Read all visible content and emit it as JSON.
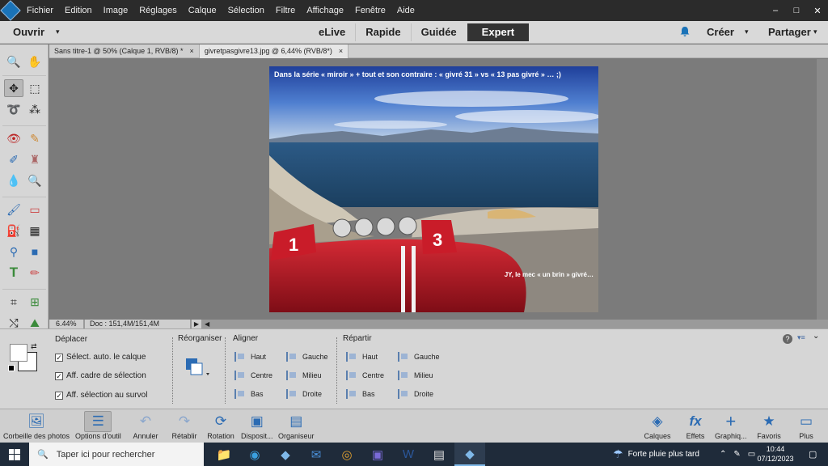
{
  "menubar": {
    "items": [
      "Fichier",
      "Edition",
      "Image",
      "Réglages",
      "Calque",
      "Sélection",
      "Filtre",
      "Affichage",
      "Fenêtre",
      "Aide"
    ],
    "window_controls": [
      "–",
      "□",
      "✕"
    ]
  },
  "modebar": {
    "open_label": "Ouvrir",
    "tabs": [
      "eLive",
      "Rapide",
      "Guidée",
      "Expert"
    ],
    "active_tab": "Expert",
    "create_label": "Créer",
    "share_label": "Partager"
  },
  "doc_tabs": [
    {
      "label": "Sans titre-1 @ 50% (Calque 1, RVB/8) *",
      "close": "×"
    },
    {
      "label": "givretpasgivre13.jpg @ 6,44% (RVB/8*)",
      "close": "×"
    }
  ],
  "photo": {
    "caption_top": "Dans la série « miroir » + tout et son contraire : « givré 31 » vs « 13 pas givré » … ;)",
    "caption_bottom": "JY, le mec « un brin » givré…",
    "number_left": "1",
    "number_right": "3"
  },
  "status": {
    "zoom": "6.44%",
    "doc_info": "Doc : 151,4M/151,4M",
    "arrow": "▶"
  },
  "options": {
    "move_title": "Déplacer",
    "checks": [
      {
        "label": "Sélect. auto. le calque",
        "checked": "✓"
      },
      {
        "label": "Aff. cadre de sélection",
        "checked": "✓"
      },
      {
        "label": "Aff. sélection au survol",
        "checked": "✓"
      }
    ],
    "arrange_title": "Réorganiser",
    "align_title": "Aligner",
    "align_items": [
      "Haut",
      "Centre",
      "Bas",
      "Gauche",
      "Milieu",
      "Droite"
    ],
    "distribute_title": "Répartir",
    "distribute_items": [
      "Haut",
      "Centre",
      "Bas",
      "Gauche",
      "Milieu",
      "Droite"
    ]
  },
  "app_taskbar": [
    {
      "label": "Corbeille des photos",
      "icon": "photo-bin-icon"
    },
    {
      "label": "Options d'outil",
      "icon": "tool-options-icon"
    },
    {
      "label": "Annuler",
      "icon": "undo-icon"
    },
    {
      "label": "Rétablir",
      "icon": "redo-icon"
    },
    {
      "label": "Rotation",
      "icon": "rotate-icon"
    },
    {
      "label": "Disposit...",
      "icon": "layout-icon"
    },
    {
      "label": "Organiseur",
      "icon": "organizer-icon"
    },
    {
      "label": "Calques",
      "icon": "layers-icon"
    },
    {
      "label": "Effets",
      "icon": "fx-icon"
    },
    {
      "label": "Graphiq...",
      "icon": "graphics-icon"
    },
    {
      "label": "Favoris",
      "icon": "favorites-icon"
    },
    {
      "label": "Plus",
      "icon": "more-icon"
    }
  ],
  "windows": {
    "search_placeholder": "Taper ici pour rechercher",
    "weather": "Forte pluie plus tard",
    "time": "10:44",
    "date": "07/12/2023"
  },
  "colors": {
    "accent": "#1a73b8",
    "menubar_bg": "#2b2b2b",
    "panel_bg": "#d6d6d6",
    "taskbar_bg": "#1f2b3a"
  }
}
